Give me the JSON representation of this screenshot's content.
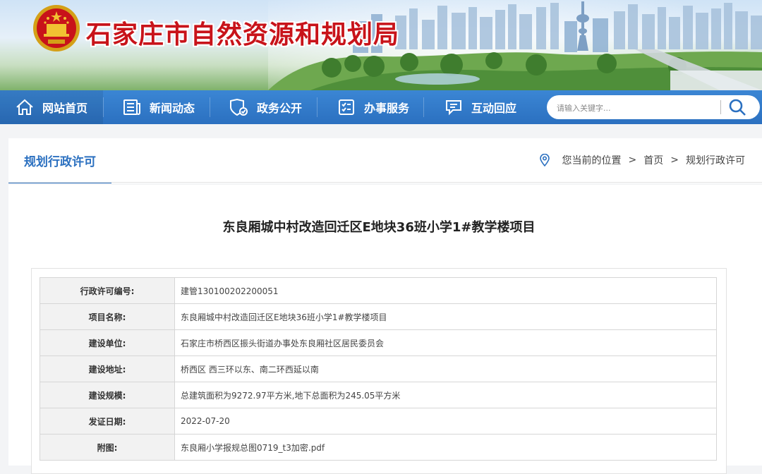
{
  "header": {
    "site_title": "石家庄市自然资源和规划局",
    "emblem_icon": "national-emblem-icon",
    "title_color": "#c8131a"
  },
  "nav": {
    "background": "#2b70c0",
    "items": [
      {
        "label": "网站首页",
        "icon": "home-icon"
      },
      {
        "label": "新闻动态",
        "icon": "newspaper-icon"
      },
      {
        "label": "政务公开",
        "icon": "shield-check-icon"
      },
      {
        "label": "办事服务",
        "icon": "checklist-icon"
      },
      {
        "label": "互动回应",
        "icon": "chat-icon"
      }
    ],
    "search": {
      "placeholder": "请输入关键字...",
      "icon": "search-icon"
    }
  },
  "breadcrumb": {
    "section_title": "规划行政许可",
    "location_label": "您当前的位置",
    "items": [
      "首页",
      "规划行政许可"
    ],
    "separator": ">"
  },
  "article": {
    "title": "东良厢城中村改造回迁区E地块36班小学1#教学楼项目",
    "rows": [
      {
        "label": "行政许可编号:",
        "value": "建管130100202200051"
      },
      {
        "label": "项目名称:",
        "value": "东良厢城中村改造回迁区E地块36班小学1#教学楼项目"
      },
      {
        "label": "建设单位:",
        "value": "石家庄市桥西区振头街道办事处东良厢社区居民委员会"
      },
      {
        "label": "建设地址:",
        "value": "桥西区 西三环以东、南二环西延以南"
      },
      {
        "label": "建设规模:",
        "value": "总建筑面积为9272.97平方米,地下总面积为245.05平方米"
      },
      {
        "label": "发证日期:",
        "value": "2022-07-20"
      },
      {
        "label": "附图:",
        "value": "东良厢小学报规总图0719_t3加密.pdf"
      }
    ]
  }
}
